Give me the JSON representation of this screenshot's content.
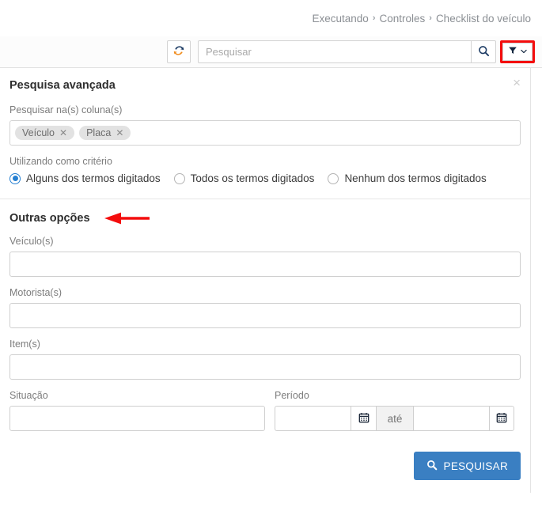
{
  "breadcrumb": {
    "items": [
      "Executando",
      "Controles",
      "Checklist do veículo"
    ],
    "separator": "›"
  },
  "toolbar": {
    "refresh_icon": "refresh-icon",
    "search_placeholder": "Pesquisar",
    "search_value": "",
    "search_icon": "magnifier-icon",
    "filter_icon": "funnel-icon",
    "filter_chevron": "chevron-down-icon",
    "highlight_color": "#f40d0d"
  },
  "panel": {
    "title": "Pesquisa avançada",
    "close_label": "×",
    "columns_label": "Pesquisar na(s) coluna(s)",
    "column_tags": [
      {
        "label": "Veículo",
        "remove": "✕"
      },
      {
        "label": "Placa",
        "remove": "✕"
      }
    ],
    "criteria_label": "Utilizando como critério",
    "criteria_options": [
      {
        "label": "Alguns dos termos digitados",
        "selected": true
      },
      {
        "label": "Todos os termos digitados",
        "selected": false
      },
      {
        "label": "Nenhum dos termos digitados",
        "selected": false
      }
    ],
    "other_options_title": "Outras opções",
    "fields": [
      {
        "label": "Veículo(s)",
        "value": "",
        "placeholder": ""
      },
      {
        "label": "Motorista(s)",
        "value": "",
        "placeholder": ""
      },
      {
        "label": "Item(s)",
        "value": "",
        "placeholder": ""
      }
    ],
    "situacao": {
      "label": "Situação",
      "value": "",
      "placeholder": ""
    },
    "periodo": {
      "label": "Período",
      "start_value": "",
      "end_value": "",
      "separator": "até",
      "calendar_icon": "calendar-icon"
    },
    "submit": {
      "label": "PESQUISAR",
      "icon": "magnifier-icon",
      "color": "#3a7fc2"
    }
  },
  "annotations": {
    "arrow_color": "#f40d0d",
    "arrow_target": "Outras opções"
  },
  "accent": {
    "radio_blue": "#2680d2",
    "panel_border": "#e4e4e4"
  }
}
